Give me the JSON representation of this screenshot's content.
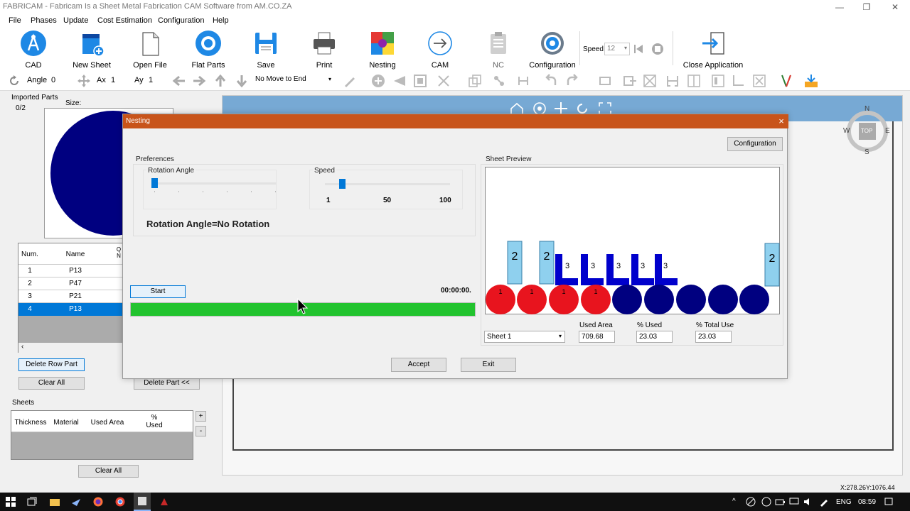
{
  "window": {
    "title": "FABRICAM - Fabricam Is a Sheet Metal Fabrication CAM Software from AM.CO.ZA"
  },
  "menu": [
    "File",
    "Phases",
    "Update",
    "Cost Estimation",
    "Configuration",
    "Help"
  ],
  "ribbon": {
    "cad": "CAD",
    "new_sheet": "New Sheet",
    "open_file": "Open File",
    "flat_parts": "Flat Parts",
    "save": "Save",
    "print": "Print",
    "nesting": "Nesting",
    "cam": "CAM",
    "nc": "NC",
    "configuration": "Configuration",
    "speed_label": "Speed",
    "speed_value": "12",
    "close_app": "Close Application"
  },
  "toolbar2": {
    "angle_label": "Angle",
    "angle_value": "0",
    "ax_label": "Ax",
    "ax_value": "1",
    "ay_label": "Ay",
    "ay_value": "1",
    "move_select": "No Move to End"
  },
  "left": {
    "imported_parts": "Imported Parts",
    "count": "0/2",
    "size_label": "Size:",
    "table_headers": {
      "num": "Num.",
      "name": "Name",
      "qty": "Q\nN"
    },
    "rows": [
      {
        "num": "1",
        "name": "P13"
      },
      {
        "num": "2",
        "name": "P47"
      },
      {
        "num": "3",
        "name": "P21"
      },
      {
        "num": "4",
        "name": "P13"
      }
    ],
    "delete_row": "Delete Row Part",
    "clear_all": "Clear All",
    "delete_part": "Delete Part <<",
    "sheets_label": "Sheets",
    "sheets_headers": {
      "thickness": "Thickness",
      "material": "Material",
      "used_area": "Used Area",
      "pct_used": "%\nUsed"
    },
    "plus": "+",
    "minus": "-",
    "clear_all2": "Clear All"
  },
  "compass": {
    "n": "N",
    "s": "S",
    "e": "E",
    "w": "W",
    "top": "TOP"
  },
  "dialog": {
    "title": "Nesting",
    "close": "×",
    "configuration_btn": "Configuration",
    "preferences": "Preferences",
    "rotation_angle": "Rotation Angle",
    "speed": "Speed",
    "speed_ticks": [
      "1",
      "50",
      "100"
    ],
    "rotation_status": "Rotation Angle=No Rotation",
    "start": "Start",
    "timer": "00:00:00.",
    "sheet_preview": "Sheet Preview",
    "sheet_select": "Sheet 1",
    "used_area_label": "Used Area",
    "used_area_value": "709.68",
    "pct_used_label": "% Used",
    "pct_used_value": "23.03",
    "pct_total_label": "% Total Use",
    "pct_total_value": "23.03",
    "accept": "Accept",
    "exit": "Exit",
    "progress": 1.0,
    "rotation_slider": 0,
    "speed_slider": 0.12,
    "preview_labels": {
      "two": "2",
      "three": "3",
      "one": "1"
    }
  },
  "status": {
    "coords": "X:278.26Y:1076.44"
  },
  "taskbar": {
    "lang": "ENG",
    "time": "08:59"
  },
  "colors": {
    "accent": "#c8541a",
    "selected": "#0078d7",
    "progress": "#22c32e",
    "red_part": "#e8141e",
    "navy_part": "#000080",
    "light_blue": "#8fd0ee"
  }
}
